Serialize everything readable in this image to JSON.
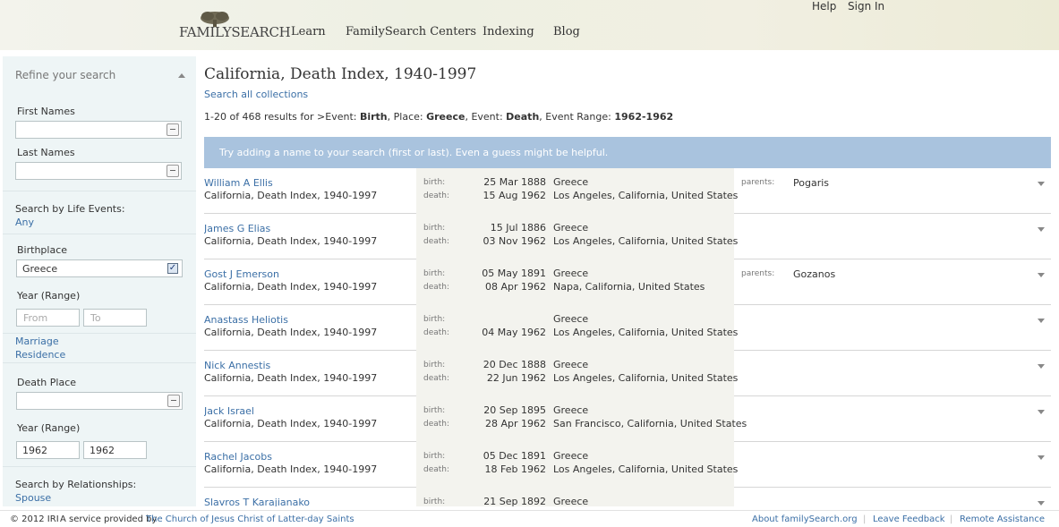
{
  "header": {
    "logo_text": "FAMILYSEARCH",
    "nav": [
      "Learn",
      "FamilySearch Centers",
      "Indexing",
      "Blog"
    ],
    "help": "Help",
    "sign_in": "Sign In"
  },
  "sidebar": {
    "title": "Refine your search",
    "first_names_label": "First Names",
    "last_names_label": "Last Names",
    "life_events_label": "Search by Life Events:",
    "life_events_value": "Any",
    "birthplace_label": "Birthplace",
    "birthplace_value": "Greece",
    "year_range_label": "Year (Range)",
    "from_placeholder": "From",
    "to_placeholder": "To",
    "marriage": "Marriage",
    "residence": "Residence",
    "death_place_label": "Death Place",
    "death_year_label": "Year (Range)",
    "death_from": "1962",
    "death_to": "1962",
    "relationships_label": "Search by Relationships:",
    "spouse": "Spouse"
  },
  "main": {
    "title": "California, Death Index, 1940-1997",
    "search_all": "Search all collections",
    "summary": {
      "prefix": "1-20 of 468 results for >Event:",
      "event1": "Birth",
      "place_lbl": ", Place:",
      "place": "Greece",
      "event2_lbl": ", Event:",
      "event2": "Death",
      "range_lbl": ", Event Range:",
      "range": "1962-1962"
    },
    "tip": "Try adding a name to your search (first or last). Even a guess might be helpful.",
    "birth_label": "birth:",
    "death_label": "death:",
    "parents_label": "parents:",
    "results": [
      {
        "name": "William A Ellis",
        "collection": "California, Death Index, 1940-1997",
        "birth_date": "25 Mar 1888",
        "birth_place": "Greece",
        "death_date": "15 Aug 1962",
        "death_place": "Los Angeles, California, United States",
        "parents": "Pogaris"
      },
      {
        "name": "James G Elias",
        "collection": "California, Death Index, 1940-1997",
        "birth_date": "15 Jul 1886",
        "birth_place": "Greece",
        "death_date": "03 Nov 1962",
        "death_place": "Los Angeles, California, United States",
        "parents": ""
      },
      {
        "name": "Gost J Emerson",
        "collection": "California, Death Index, 1940-1997",
        "birth_date": "05 May 1891",
        "birth_place": "Greece",
        "death_date": "08 Apr 1962",
        "death_place": "Napa, California, United States",
        "parents": "Gozanos"
      },
      {
        "name": "Anastass Heliotis",
        "collection": "California, Death Index, 1940-1997",
        "birth_date": "",
        "birth_place": "Greece",
        "death_date": "04 May 1962",
        "death_place": "Los Angeles, California, United States",
        "parents": ""
      },
      {
        "name": "Nick Annestis",
        "collection": "California, Death Index, 1940-1997",
        "birth_date": "20 Dec 1888",
        "birth_place": "Greece",
        "death_date": "22 Jun 1962",
        "death_place": "Los Angeles, California, United States",
        "parents": ""
      },
      {
        "name": "Jack Israel",
        "collection": "California, Death Index, 1940-1997",
        "birth_date": "20 Sep 1895",
        "birth_place": "Greece",
        "death_date": "28 Apr 1962",
        "death_place": "San Francisco, California, United States",
        "parents": ""
      },
      {
        "name": "Rachel Jacobs",
        "collection": "California, Death Index, 1940-1997",
        "birth_date": "05 Dec 1891",
        "birth_place": "Greece",
        "death_date": "18 Feb 1962",
        "death_place": "Los Angeles, California, United States",
        "parents": ""
      },
      {
        "name": "Slavros T Karajianako",
        "collection": "",
        "birth_date": "21 Sep 1892",
        "birth_place": "Greece",
        "death_date": "",
        "death_place": "",
        "parents": ""
      }
    ]
  },
  "footer": {
    "copyright": "© 2012 IRI",
    "service": "A service provided by",
    "church": "The Church of Jesus Christ of Latter-day Saints",
    "about": "About familySearch.org",
    "feedback": "Leave Feedback",
    "remote": "Remote Assistance",
    "sep": "|"
  }
}
